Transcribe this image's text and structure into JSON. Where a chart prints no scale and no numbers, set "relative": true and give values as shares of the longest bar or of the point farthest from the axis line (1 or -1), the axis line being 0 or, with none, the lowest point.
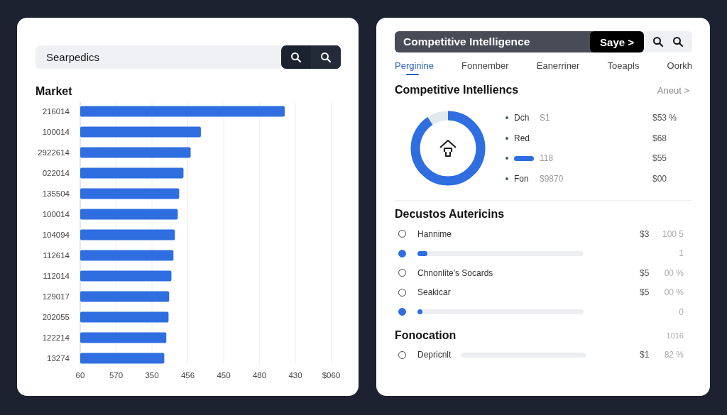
{
  "left_panel": {
    "search": {
      "value": "Searpedics"
    },
    "market": {
      "title": "Market",
      "chart_data": {
        "type": "bar",
        "orientation": "horizontal",
        "categories": [
          "216014",
          "100014",
          "2922614",
          "022014",
          "135504",
          "100014",
          "104094",
          "112614",
          "112014",
          "129017",
          "202055",
          "122214",
          "13274"
        ],
        "values": [
          1,
          0.59,
          0.54,
          0.505,
          0.484,
          0.477,
          0.463,
          0.456,
          0.446,
          0.435,
          0.432,
          0.421,
          0.411
        ],
        "relative": true
      },
      "x_axis_labels": [
        "60",
        "570",
        "350",
        "456",
        "450",
        "480",
        "430",
        "$060"
      ]
    }
  },
  "right_panel": {
    "header": {
      "title": "Competitive Intelligence",
      "button": "Saye >"
    },
    "tabs": [
      {
        "label": "Perginine",
        "selected": true
      },
      {
        "label": "Fonnember",
        "selected": false
      },
      {
        "label": "Eanerriner",
        "selected": false
      },
      {
        "label": "Toeapls",
        "selected": false
      },
      {
        "label": "Oorkh",
        "selected": false
      }
    ],
    "overview": {
      "title": "Competitive Intelliencs",
      "link": "Aneut >",
      "legend": [
        {
          "kind": "text",
          "label": "Dch",
          "value": "S1",
          "amount": "$53 %"
        },
        {
          "kind": "text",
          "label": "Red",
          "amount": "$68"
        },
        {
          "kind": "bar",
          "value": "118",
          "amount": "$55"
        },
        {
          "kind": "text",
          "label": "Fon",
          "value": "$9870",
          "amount": "$00"
        }
      ]
    },
    "sections": [
      {
        "title": "Decustos Autericins",
        "rows": [
          {
            "kind": "option",
            "selected": false,
            "label": "Hannime",
            "amount": "$3",
            "percent": "100 5"
          },
          {
            "kind": "progress",
            "selected": true,
            "level": 0.06,
            "percent": "1"
          },
          {
            "kind": "option",
            "selected": false,
            "label": "Chnonlite's Socards",
            "amount": "$5",
            "percent": "00 %"
          },
          {
            "kind": "option",
            "selected": false,
            "label": "Seakicar",
            "amount": "$5",
            "percent": "00 %"
          },
          {
            "kind": "progress",
            "selected": true,
            "level": 0.03,
            "percent": "0"
          }
        ]
      },
      {
        "title": "Fonocation",
        "note": "1016",
        "rows": [
          {
            "kind": "option",
            "selected": false,
            "label": "Depricnlt",
            "track": true,
            "amount": "$1",
            "percent": "82 %"
          }
        ]
      }
    ]
  }
}
